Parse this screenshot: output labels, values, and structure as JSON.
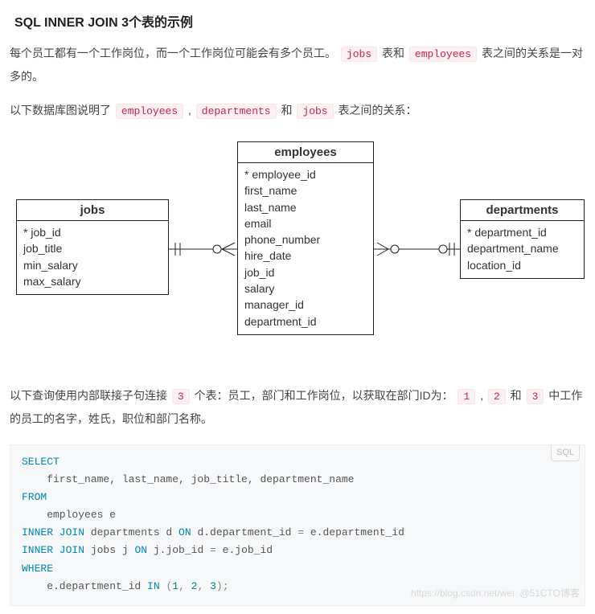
{
  "title": "SQL INNER JOIN 3个表的示例",
  "para1": {
    "t1": "每个员工都有一个工作岗位，而一个工作岗位可能会有多个员工。 ",
    "c1": "jobs",
    "t2": " 表和 ",
    "c2": "employees",
    "t3": " 表之间的关系是一对多的。"
  },
  "para2": {
    "t1": "以下数据库图说明了 ",
    "c1": "employees",
    "t2": " , ",
    "c2": "departments",
    "t3": " 和 ",
    "c3": "jobs",
    "t4": " 表之间的关系："
  },
  "diagram": {
    "jobs": {
      "name": "jobs",
      "fields": [
        "* job_id",
        "job_title",
        "min_salary",
        "max_salary"
      ]
    },
    "employees": {
      "name": "employees",
      "fields": [
        "* employee_id",
        "first_name",
        "last_name",
        "email",
        "phone_number",
        "hire_date",
        "job_id",
        "salary",
        "manager_id",
        "department_id"
      ]
    },
    "departments": {
      "name": "departments",
      "fields": [
        "* department_id",
        "department_name",
        "location_id"
      ]
    }
  },
  "para3": {
    "t1": "以下查询使用内部联接子句连接 ",
    "c1": "3",
    "t2": " 个表：员工，部门和工作岗位，以获取在部门ID为： ",
    "c2": "1",
    "t3": " , ",
    "c3": "2",
    "t4": " 和 ",
    "c4": "3",
    "t5": " 中工作的员工的名字，姓氏，职位和部门名称。"
  },
  "code": {
    "lang": "SQL",
    "select": "SELECT",
    "cols": "    first_name, last_name, job_title, department_name",
    "from": "FROM",
    "tbl": "    employees e",
    "j1a": "INNER JOIN",
    "j1b": " departments d ",
    "j1c": "ON",
    "j1d": " d.department_id ",
    "j1e": "=",
    "j1f": " e.department_id",
    "j2a": "INNER JOIN",
    "j2b": " jobs j ",
    "j2c": "ON",
    "j2d": " j.job_id ",
    "j2e": "=",
    "j2f": " e.job_id",
    "where": "WHERE",
    "cond_a": "    e.department_id ",
    "in": "IN",
    "lp": " (",
    "n1": "1",
    "n2": "2",
    "n3": "3",
    "rp": ");"
  },
  "watermark": "https://blog.csdn.net/wei  @51CTO博客"
}
